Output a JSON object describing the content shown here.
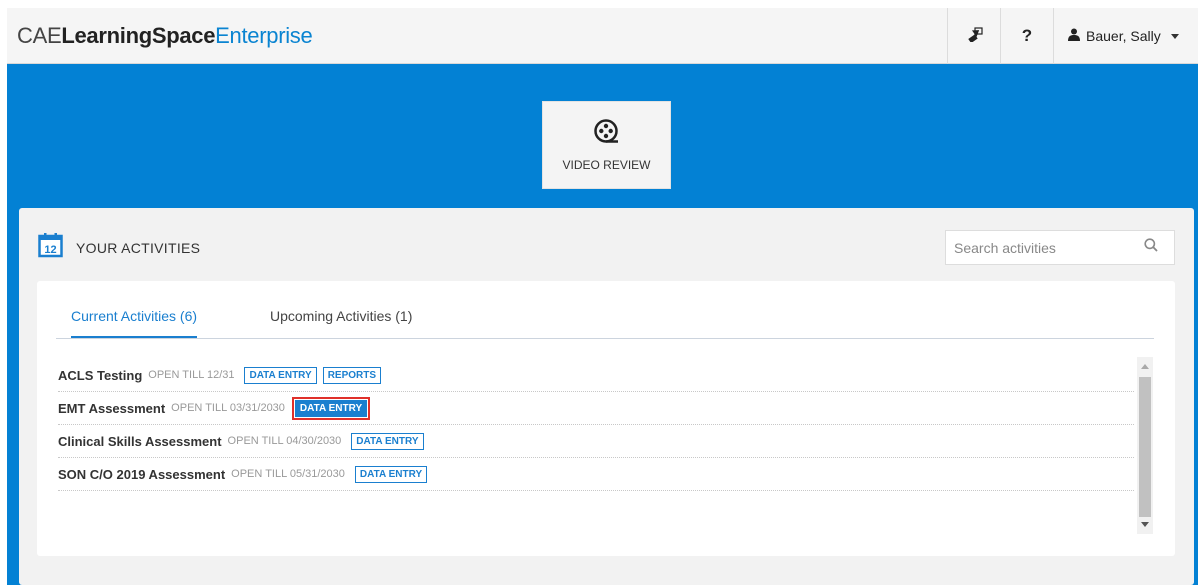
{
  "header": {
    "logo_cae": "CAE",
    "logo_learningspace": "LearningSpace",
    "logo_enterprise": "Enterprise",
    "help_label": "?",
    "user_name": "Bauer, Sally"
  },
  "video_review": {
    "label": "VIDEO REVIEW"
  },
  "activities": {
    "title": "YOUR ACTIVITIES",
    "calendar_day": "12",
    "search_placeholder": "Search activities",
    "tabs": [
      {
        "label": "Current Activities (6)"
      },
      {
        "label": "Upcoming Activities (1)"
      }
    ],
    "items": [
      {
        "name": "ACLS Testing",
        "open": "OPEN TILL 12/31",
        "actions": [
          "DATA ENTRY",
          "REPORTS"
        ]
      },
      {
        "name": "EMT Assessment",
        "open": "OPEN TILL 03/31/2030",
        "actions": [
          "DATA ENTRY"
        ]
      },
      {
        "name": "Clinical Skills Assessment",
        "open": "OPEN TILL 04/30/2030",
        "actions": [
          "DATA ENTRY"
        ]
      },
      {
        "name": "SON C/O 2019 Assessment",
        "open": "OPEN TILL 05/31/2030",
        "actions": [
          "DATA ENTRY"
        ]
      }
    ]
  },
  "colors": {
    "brand_blue": "#0381d4",
    "accent": "#1a7fcf",
    "highlight_border": "#e0302a"
  }
}
